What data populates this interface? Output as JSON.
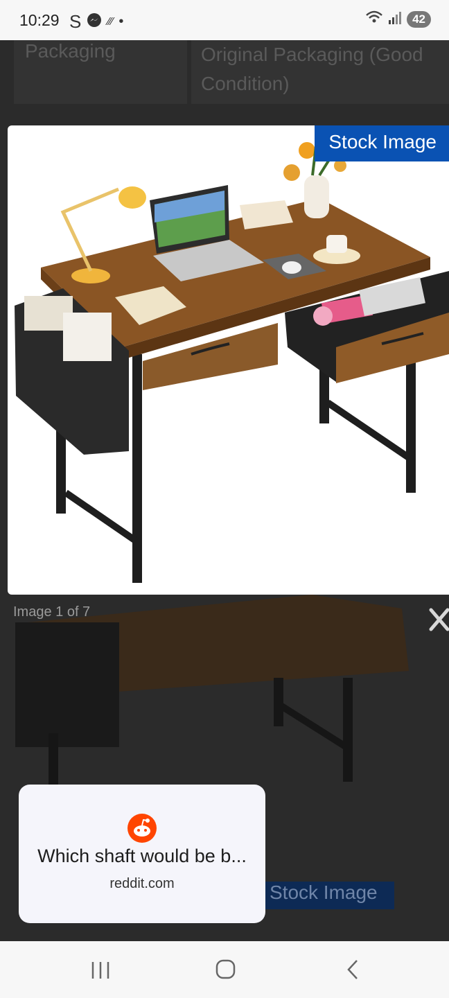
{
  "status_bar": {
    "time": "10:29",
    "battery": "42"
  },
  "spec_row": {
    "left": "Packaging",
    "right": "Original Packaging (Good Condition)"
  },
  "viewer": {
    "stock_label": "Stock Image",
    "counter": "Image 1 of 7"
  },
  "toast": {
    "title": "Which shaft would be b...",
    "domain": "reddit.com"
  },
  "background_tag": "Stock Image",
  "colors": {
    "accent_blue": "#0a52b3",
    "reddit_orange": "#ff4500"
  }
}
